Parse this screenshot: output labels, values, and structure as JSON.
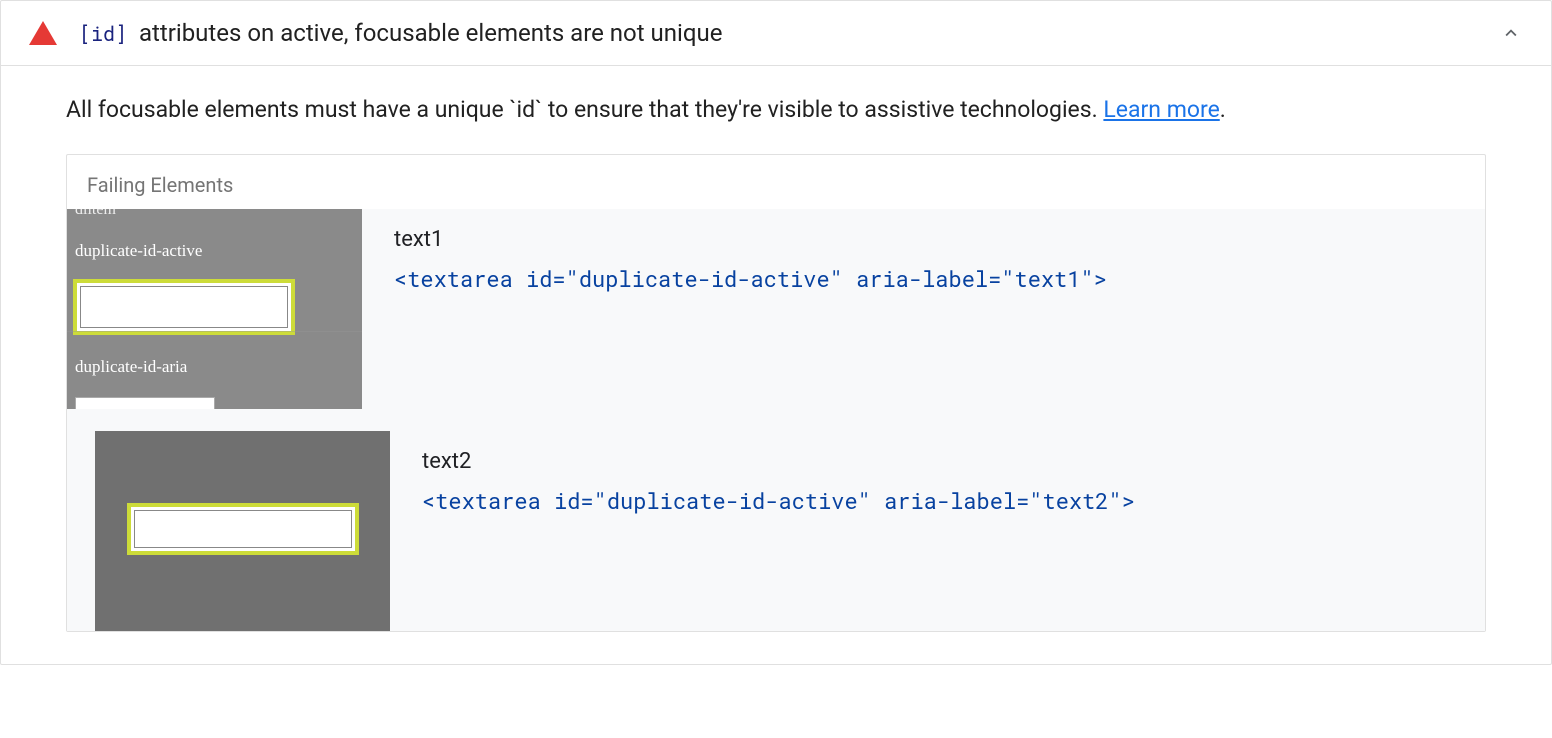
{
  "audit": {
    "codeBadge": "[id]",
    "titleSuffix": " attributes on active, focusable elements are not unique",
    "description": "All focusable elements must have a unique `id` to ensure that they're visible to assistive technologies. ",
    "learnMoreText": "Learn more",
    "descriptionSuffix": "."
  },
  "failingElements": {
    "header": "Failing Elements",
    "items": [
      {
        "label": "text1",
        "snippet": "<textarea id=\"duplicate-id-active\" aria-label=\"text1\">",
        "thumb": {
          "topLabelPartial": "dlitem",
          "label1": "duplicate-id-active",
          "label2": "duplicate-id-aria"
        }
      },
      {
        "label": "text2",
        "snippet": "<textarea id=\"duplicate-id-active\" aria-label=\"text2\">"
      }
    ]
  }
}
